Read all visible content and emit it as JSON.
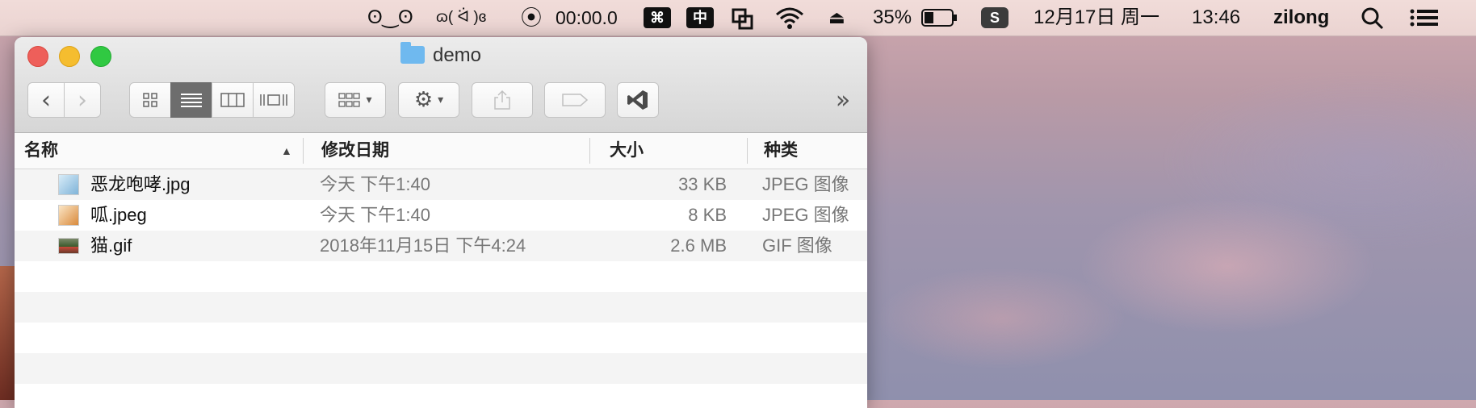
{
  "menubar": {
    "items": [
      "ʘ‿ʘ",
      "ɷ( ᐛ )ɞ",
      "00:00.0",
      "⌘",
      "中",
      "35%",
      "12月17日 周一",
      "13:46",
      "zilong"
    ],
    "record_time": "00:00.0",
    "battery": "35%",
    "date": "12月17日 周一",
    "time": "13:46",
    "user": "zilong",
    "cmd": "⌘",
    "input_method": "中",
    "sogou": "S"
  },
  "window": {
    "title": "demo",
    "toolbar": {
      "back": "‹",
      "forward": "›",
      "more": "»"
    },
    "columns": {
      "name": "名称",
      "date": "修改日期",
      "size": "大小",
      "kind": "种类"
    },
    "files": [
      {
        "name": "恶龙咆哮.jpg",
        "date": "今天 下午1:40",
        "size": "33 KB",
        "kind": "JPEG 图像"
      },
      {
        "name": "呱.jpeg",
        "date": "今天 下午1:40",
        "size": "8 KB",
        "kind": "JPEG 图像"
      },
      {
        "name": "猫.gif",
        "date": "2018年11月15日 下午4:24",
        "size": "2.6 MB",
        "kind": "GIF 图像"
      }
    ]
  },
  "colors": {
    "close": "#ee5f5a",
    "minimize": "#f5bd2f",
    "maximize": "#30c942",
    "folder": "#6fb9ef"
  }
}
